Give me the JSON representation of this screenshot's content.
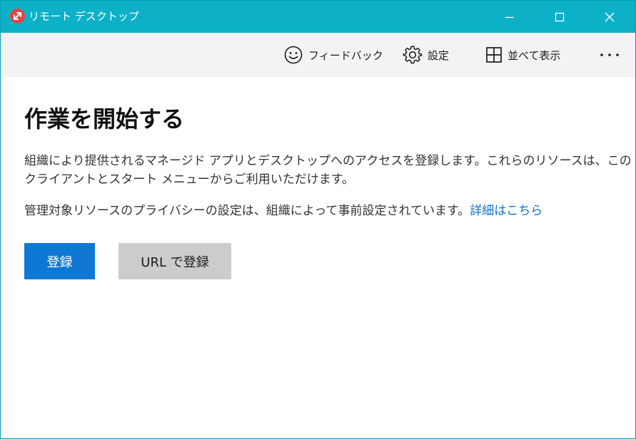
{
  "window": {
    "title": "リモート デスクトップ"
  },
  "toolbar": {
    "feedback_label": "フィードバック",
    "settings_label": "設定",
    "tile_label": "並べて表示",
    "more_label": "..."
  },
  "main": {
    "heading": "作業を開始する",
    "description_line1": "組織により提供されるマネージド アプリとデスクトップへのアクセスを登録します。これらのリソースは、この",
    "description_line2": "クライアントとスタート メニューからご利用いただけます。",
    "privacy_text": "管理対象リソースのプライバシーの設定は、組織によって事前設定されています。",
    "learn_more_link": "詳細はこちら",
    "subscribe_button": "登録",
    "subscribe_url_button": "URL で登録"
  },
  "colors": {
    "titlebar": "#0cb1c8",
    "toolbar": "#f3f3f3",
    "primary_button": "#0f78d4",
    "secondary_button": "#cccccc",
    "link": "#1470c7",
    "app_icon": "#e2473f"
  },
  "icons": {
    "app": "remote-desktop-icon",
    "feedback": "smiley-icon",
    "settings": "gear-icon",
    "tile": "grid-icon",
    "more": "ellipsis-icon"
  }
}
